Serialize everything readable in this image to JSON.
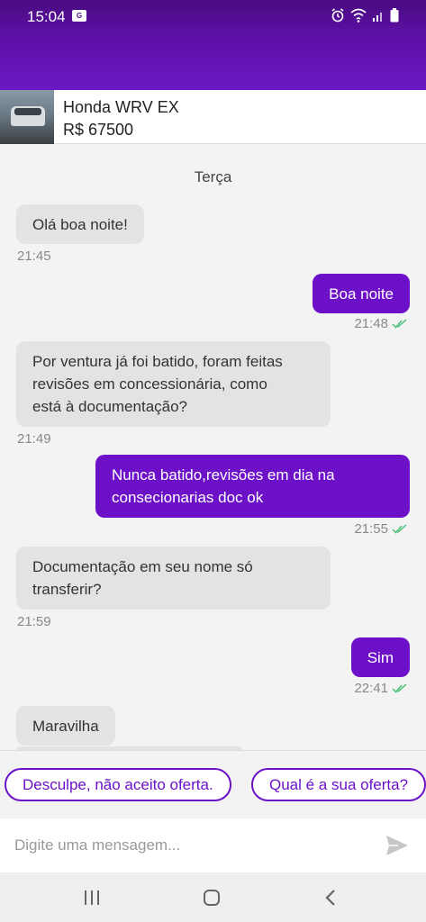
{
  "status_bar": {
    "time": "15:04",
    "mini_icon": "G"
  },
  "listing": {
    "title": "Honda WRV EX",
    "price": "R$ 67500"
  },
  "chat": {
    "day_label": "Terça",
    "messages": [
      {
        "direction": "in",
        "text": "Olá boa noite!",
        "time": "21:45"
      },
      {
        "direction": "out",
        "text": "Boa noite",
        "time": "21:48"
      },
      {
        "direction": "in",
        "lines": [
          "Por ventura já foi batido, foram feitas",
          "revisões em concessionária,  como",
          "está à documentação?"
        ],
        "time": "21:49"
      },
      {
        "direction": "out",
        "lines": [
          "Nunca batido,revisões em dia na",
          "consecionarias doc ok"
        ],
        "time": "21:55"
      },
      {
        "direction": "in",
        "lines": [
          "Documentação em seu nome só",
          "transferir?"
        ],
        "time": "21:59"
      },
      {
        "direction": "out",
        "text": "Sim",
        "time": "22:41"
      },
      {
        "direction": "in",
        "text": "Maravilha"
      }
    ]
  },
  "quick_replies": {
    "reject": "Desculpe, não aceito oferta.",
    "ask_offer": "Qual é a sua oferta?"
  },
  "composer": {
    "placeholder": "Digite uma mensagem..."
  },
  "colors": {
    "accent": "#6c11c8",
    "incoming_bubble": "#e3e3e3",
    "read_check": "#4cbf7a"
  },
  "icons": [
    "alarm-icon",
    "wifi-icon",
    "signal-icon",
    "battery-icon",
    "read-check-icon",
    "send-icon",
    "nav-recents-icon",
    "nav-home-icon",
    "nav-back-icon"
  ]
}
